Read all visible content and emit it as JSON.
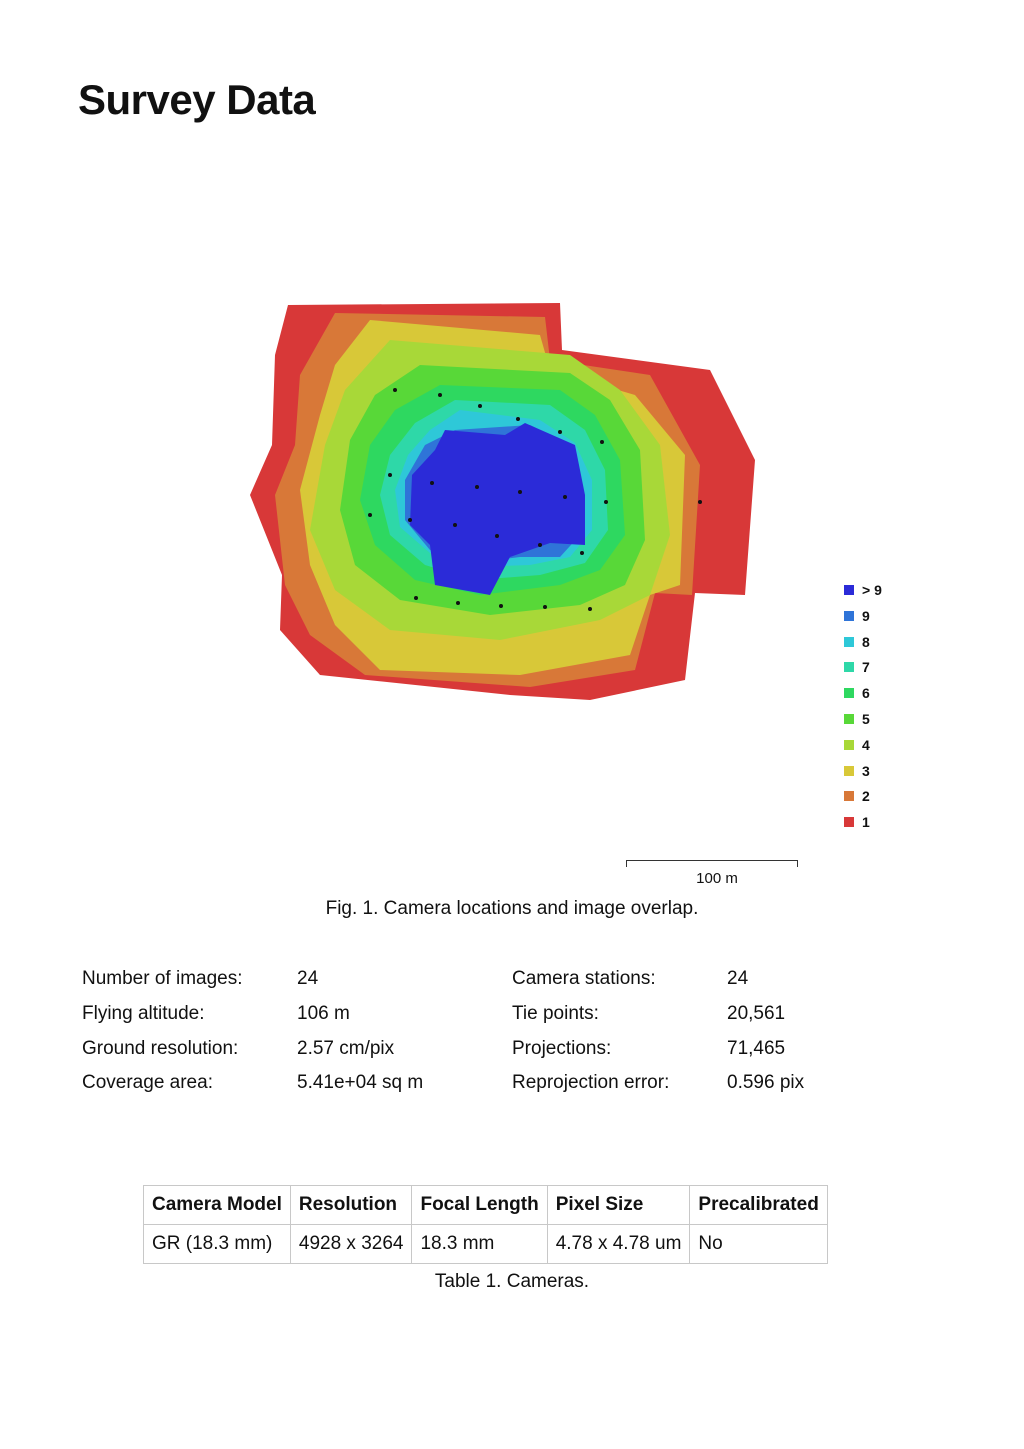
{
  "page": {
    "title": "Survey Data"
  },
  "figure": {
    "caption": "Fig. 1. Camera locations and image overlap.",
    "scale_bar_label": "100 m",
    "legend": [
      {
        "label": "> 9",
        "color": "#2b2bd8"
      },
      {
        "label": "9",
        "color": "#2f74d8"
      },
      {
        "label": "8",
        "color": "#2ec8d8"
      },
      {
        "label": "7",
        "color": "#2ed8a8"
      },
      {
        "label": "6",
        "color": "#2ed860"
      },
      {
        "label": "5",
        "color": "#58d838"
      },
      {
        "label": "4",
        "color": "#a8d838"
      },
      {
        "label": "3",
        "color": "#d8c838"
      },
      {
        "label": "2",
        "color": "#d87838"
      },
      {
        "label": "1",
        "color": "#d83838"
      }
    ]
  },
  "stats": {
    "left": [
      {
        "label": "Number of images:",
        "value": "24"
      },
      {
        "label": "Flying altitude:",
        "value": "106 m"
      },
      {
        "label": "Ground resolution:",
        "value": "2.57 cm/pix"
      },
      {
        "label": "Coverage area:",
        "value": "5.41e+04 sq m"
      }
    ],
    "right": [
      {
        "label": "Camera stations:",
        "value": "24"
      },
      {
        "label": "Tie points:",
        "value": "20,561"
      },
      {
        "label": "Projections:",
        "value": "71,465"
      },
      {
        "label": "Reprojection error:",
        "value": "0.596 pix"
      }
    ]
  },
  "cameras_table": {
    "headers": [
      "Camera Model",
      "Resolution",
      "Focal Length",
      "Pixel Size",
      "Precalibrated"
    ],
    "rows": [
      [
        "GR (18.3 mm)",
        "4928 x 3264",
        "18.3 mm",
        "4.78 x 4.78 um",
        "No"
      ]
    ],
    "caption": "Table 1. Cameras."
  }
}
